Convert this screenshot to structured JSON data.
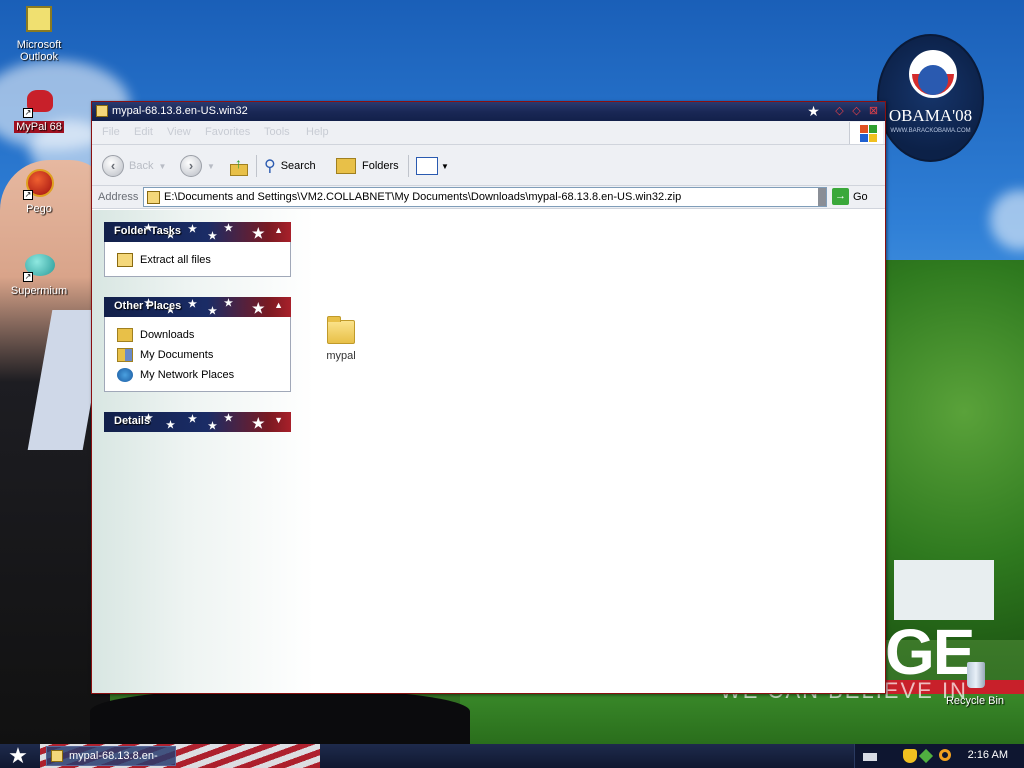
{
  "desktop": {
    "icons": [
      {
        "label": "Microsoft Outlook"
      },
      {
        "label": "MyPal 68"
      },
      {
        "label": "Pego"
      },
      {
        "label": "Supermium"
      },
      {
        "label": "Recycle Bin"
      }
    ],
    "badge": {
      "name": "OBAMA'08",
      "url": "WWW.BARACKOBAMA.COM"
    },
    "slogan": "GE",
    "slogan_sub": "WE CAN BELIEVE IN"
  },
  "window": {
    "title": "mypal-68.13.8.en-US.win32",
    "menu": [
      "File",
      "Edit",
      "View",
      "Favorites",
      "Tools",
      "Help"
    ],
    "toolbar": {
      "back_label": "Back",
      "search_label": "Search",
      "folders_label": "Folders"
    },
    "address": {
      "label": "Address",
      "value": "E:\\Documents and Settings\\VM2.COLLABNET\\My Documents\\Downloads\\mypal-68.13.8.en-US.win32.zip",
      "go_label": "Go"
    },
    "panels": {
      "folder_tasks": {
        "title": "Folder Tasks",
        "items": [
          "Extract all files"
        ]
      },
      "other_places": {
        "title": "Other Places",
        "items": [
          "Downloads",
          "My Documents",
          "My Network Places"
        ]
      },
      "details": {
        "title": "Details"
      }
    },
    "files": [
      {
        "label": "mypal"
      }
    ]
  },
  "taskbar": {
    "task_label": "mypal-68.13.8.en-",
    "clock": "2:16 AM"
  }
}
